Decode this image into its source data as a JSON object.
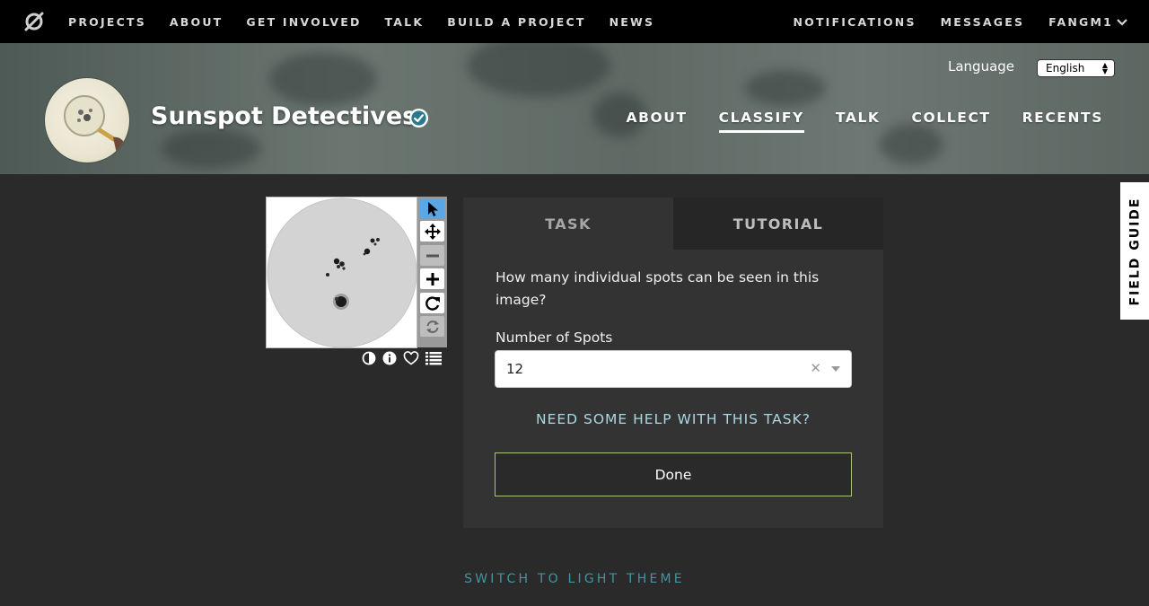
{
  "topnav": {
    "left": [
      "PROJECTS",
      "ABOUT",
      "GET INVOLVED",
      "TALK",
      "BUILD A PROJECT",
      "NEWS"
    ],
    "right": [
      "NOTIFICATIONS",
      "MESSAGES"
    ],
    "user": "FANGM1"
  },
  "header": {
    "title": "Sunspot Detectives",
    "language_label": "Language",
    "language_value": "English",
    "nav": [
      "ABOUT",
      "CLASSIFY",
      "TALK",
      "COLLECT",
      "RECENTS"
    ],
    "active_nav": "CLASSIFY"
  },
  "task": {
    "tabs": [
      "TASK",
      "TUTORIAL"
    ],
    "question": "How many individual spots can be seen in this image?",
    "select_label": "Number of Spots",
    "select_value": "12",
    "help_link": "NEED SOME HELP WITH THIS TASK?",
    "done_label": "Done"
  },
  "field_guide": "FIELD GUIDE",
  "footer": {
    "theme_toggle": "SWITCH TO LIGHT THEME"
  },
  "colors": {
    "background": "#2a2a2a",
    "panel": "#333333",
    "accent_link": "#a9d8e2",
    "done_border": "#a6c87a",
    "theme_link": "#3e97a3",
    "active_tool": "#5aa7e6"
  }
}
